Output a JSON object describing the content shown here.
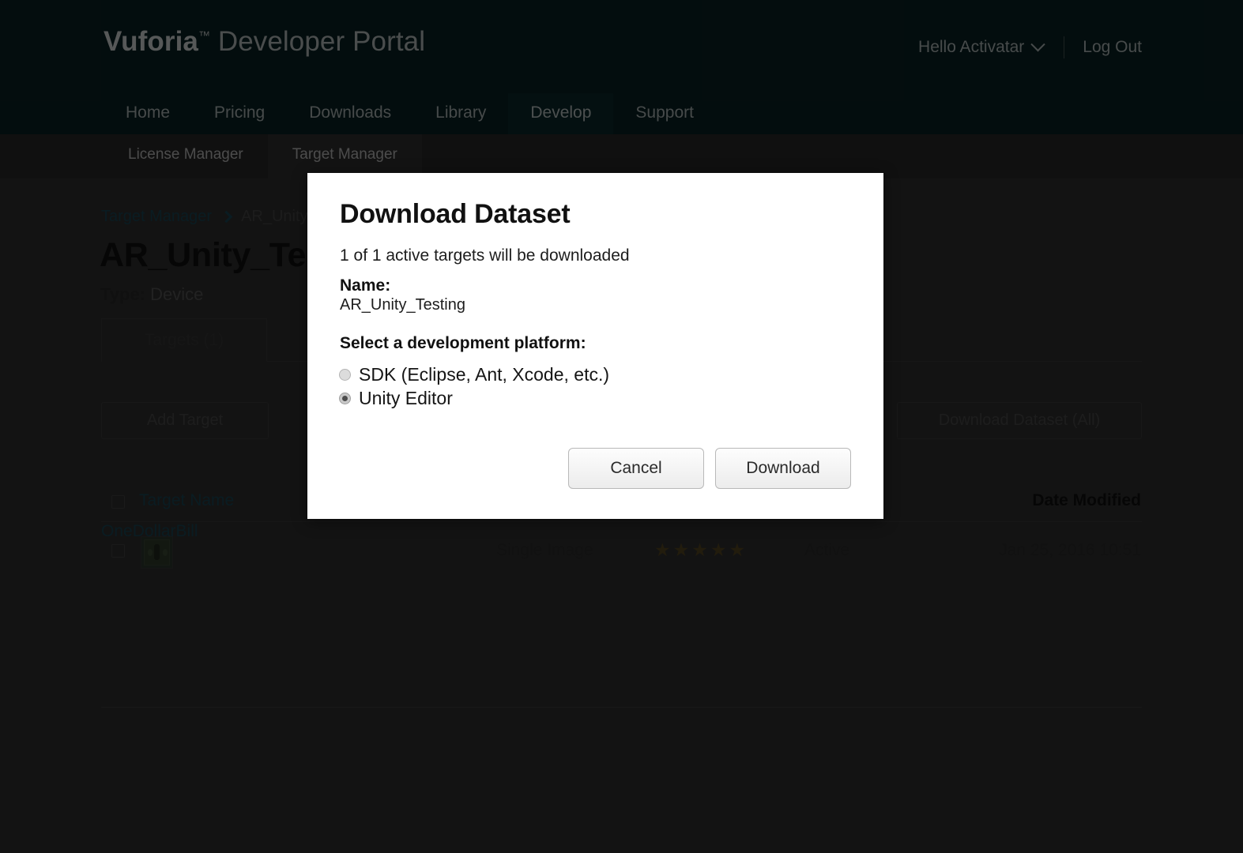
{
  "header": {
    "brand_bold": "Vuforia",
    "brand_tm": "™",
    "brand_light": "Developer Portal",
    "greeting": "Hello Activatar",
    "logout": "Log Out"
  },
  "nav": {
    "items": [
      {
        "label": "Home",
        "active": false
      },
      {
        "label": "Pricing",
        "active": false
      },
      {
        "label": "Downloads",
        "active": false
      },
      {
        "label": "Library",
        "active": false
      },
      {
        "label": "Develop",
        "active": true
      },
      {
        "label": "Support",
        "active": false
      }
    ]
  },
  "subnav": {
    "items": [
      {
        "label": "License Manager",
        "active": false
      },
      {
        "label": "Target Manager",
        "active": true
      }
    ]
  },
  "breadcrumb": {
    "root": "Target Manager",
    "current": "AR_Unity_T"
  },
  "page": {
    "title": "AR_Unity_Testin",
    "type_label": "Type:",
    "type_value": "Device",
    "tab_targets": "Targets (1)",
    "add_target_button": "Add Target",
    "download_all_button": "Download Dataset (All)"
  },
  "table": {
    "columns": {
      "name": "Target Name",
      "date": "Date Modified"
    },
    "rows": [
      {
        "name": "OneDollarBill",
        "type": "Single Image",
        "rating": 5,
        "stars": "★★★★★",
        "status": "Active",
        "date_modified": "Jan 25, 2016 10:51",
        "thumbnail": "dollar-bill-thumbnail"
      }
    ]
  },
  "dialog": {
    "title": "Download Dataset",
    "subtitle": "1 of 1 active targets will be downloaded",
    "name_label": "Name:",
    "name_value": "AR_Unity_Testing",
    "platform_label": "Select a development platform:",
    "options": [
      {
        "label": "SDK (Eclipse, Ant, Xcode, etc.)",
        "selected": false
      },
      {
        "label": "Unity Editor",
        "selected": true
      }
    ],
    "cancel_button": "Cancel",
    "download_button": "Download"
  },
  "colors": {
    "header_bg": "#0a2326",
    "body_bg": "#333333",
    "link": "#1b4a5a",
    "star": "#5a4a22",
    "focus_ring": "#a7cdf5"
  }
}
